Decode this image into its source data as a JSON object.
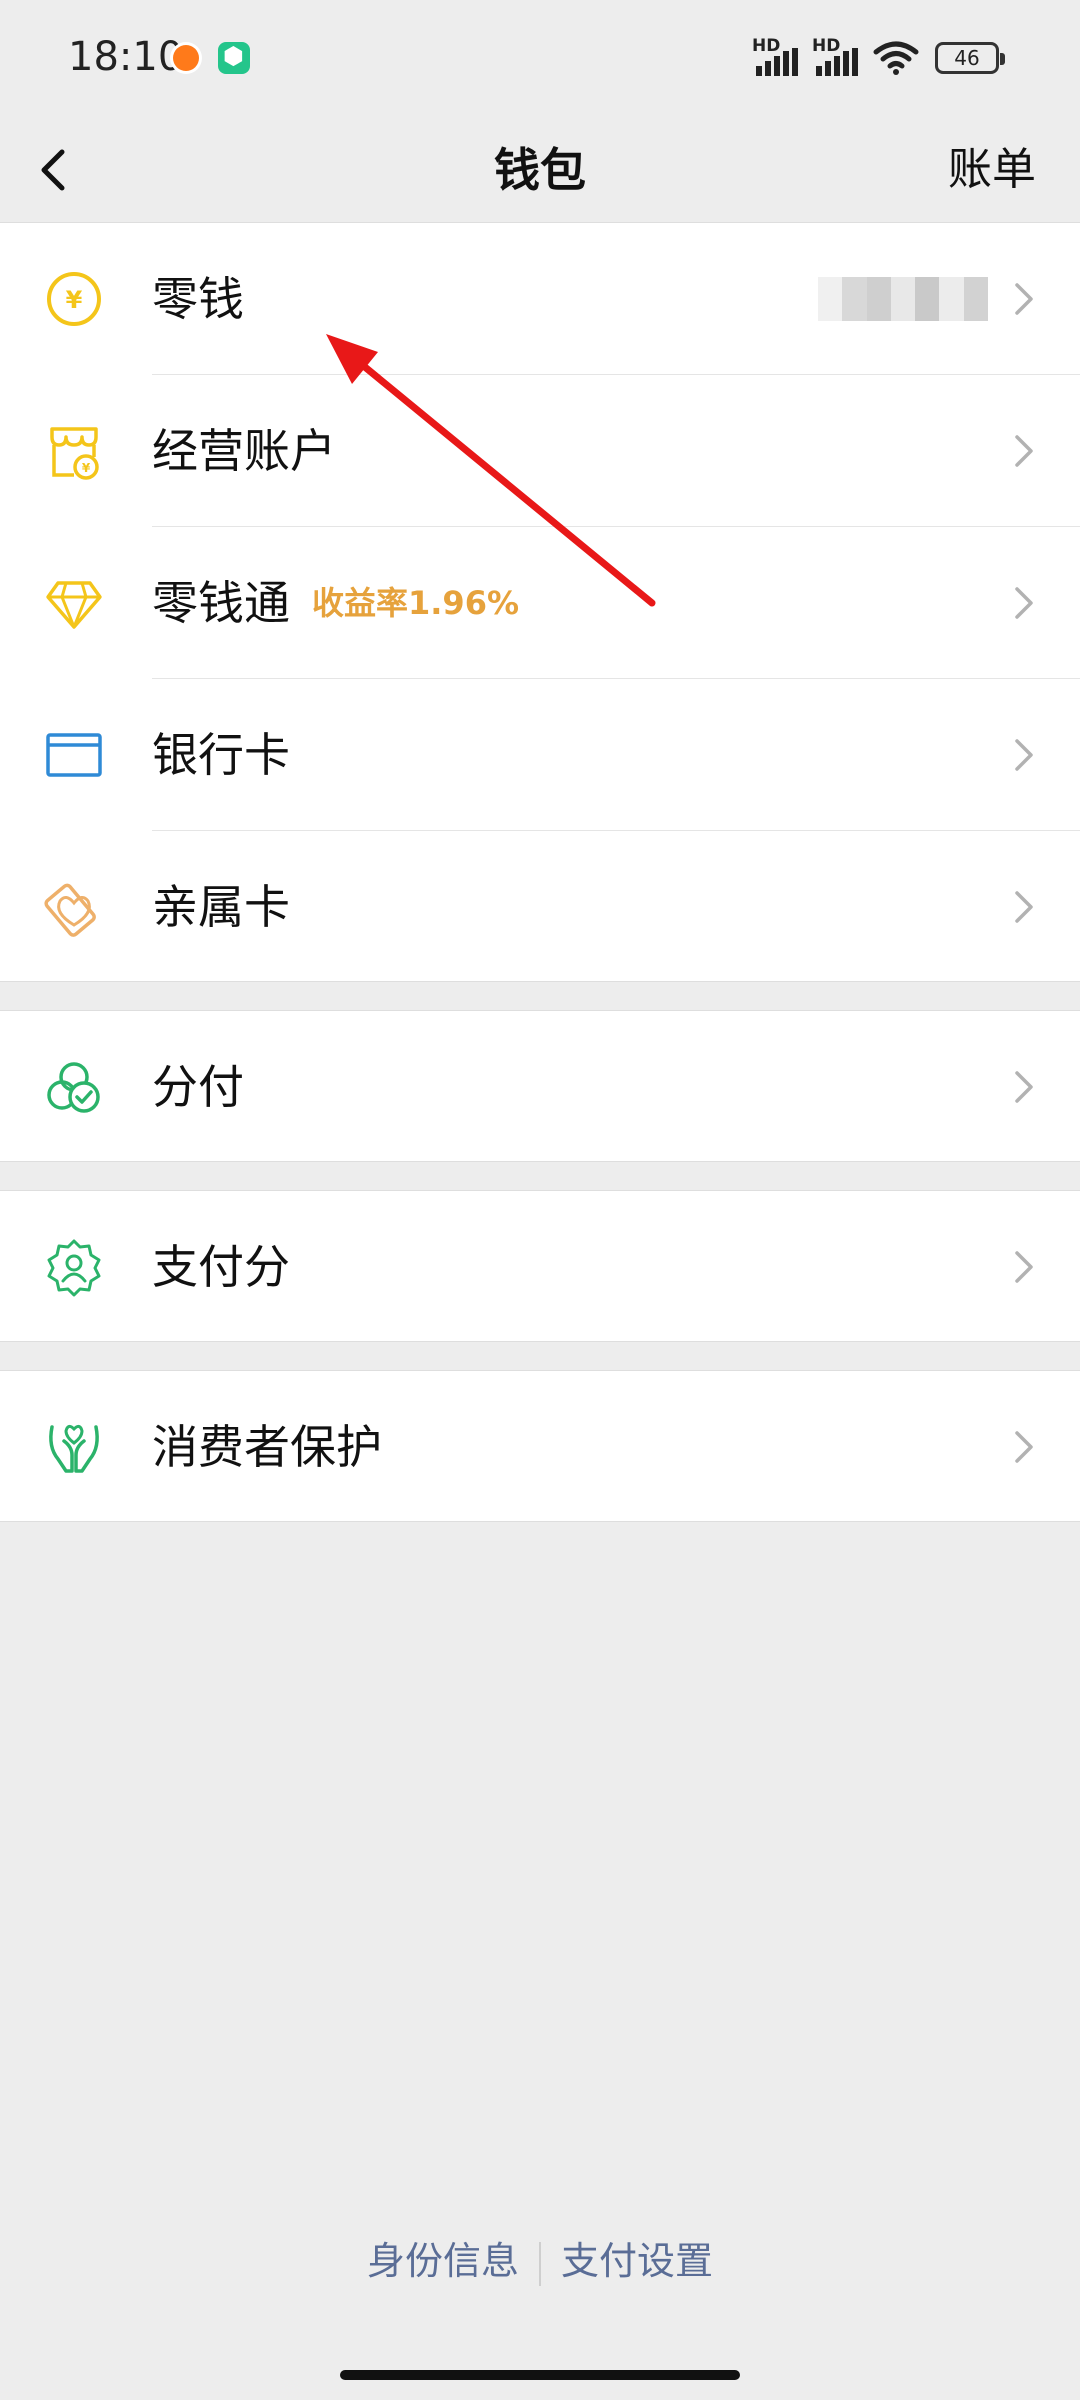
{
  "status_bar": {
    "time": "18:10",
    "network_1": "HD",
    "network_2": "HD",
    "battery": "46"
  },
  "nav": {
    "title": "钱包",
    "action": "账单"
  },
  "group1": [
    {
      "label": "零钱",
      "icon": "yuan-coin-icon"
    },
    {
      "label": "经营账户",
      "icon": "shop-icon"
    },
    {
      "label": "零钱通",
      "icon": "diamond-icon",
      "tag": "收益率1.96%"
    },
    {
      "label": "银行卡",
      "icon": "card-icon"
    },
    {
      "label": "亲属卡",
      "icon": "family-card-icon"
    }
  ],
  "group2": [
    {
      "label": "分付",
      "icon": "circles-icon"
    }
  ],
  "group3": [
    {
      "label": "支付分",
      "icon": "badge-icon"
    }
  ],
  "group4": [
    {
      "label": "消费者保护",
      "icon": "hands-icon"
    }
  ],
  "footer": {
    "identity": "身份信息",
    "payment_settings": "支付设置"
  },
  "colors": {
    "accent_green": "#2bb36a",
    "accent_yellow": "#f4c51a",
    "accent_orange": "#e6a23c",
    "link_blue": "#5a6d96",
    "annotation_red": "#e81818"
  }
}
